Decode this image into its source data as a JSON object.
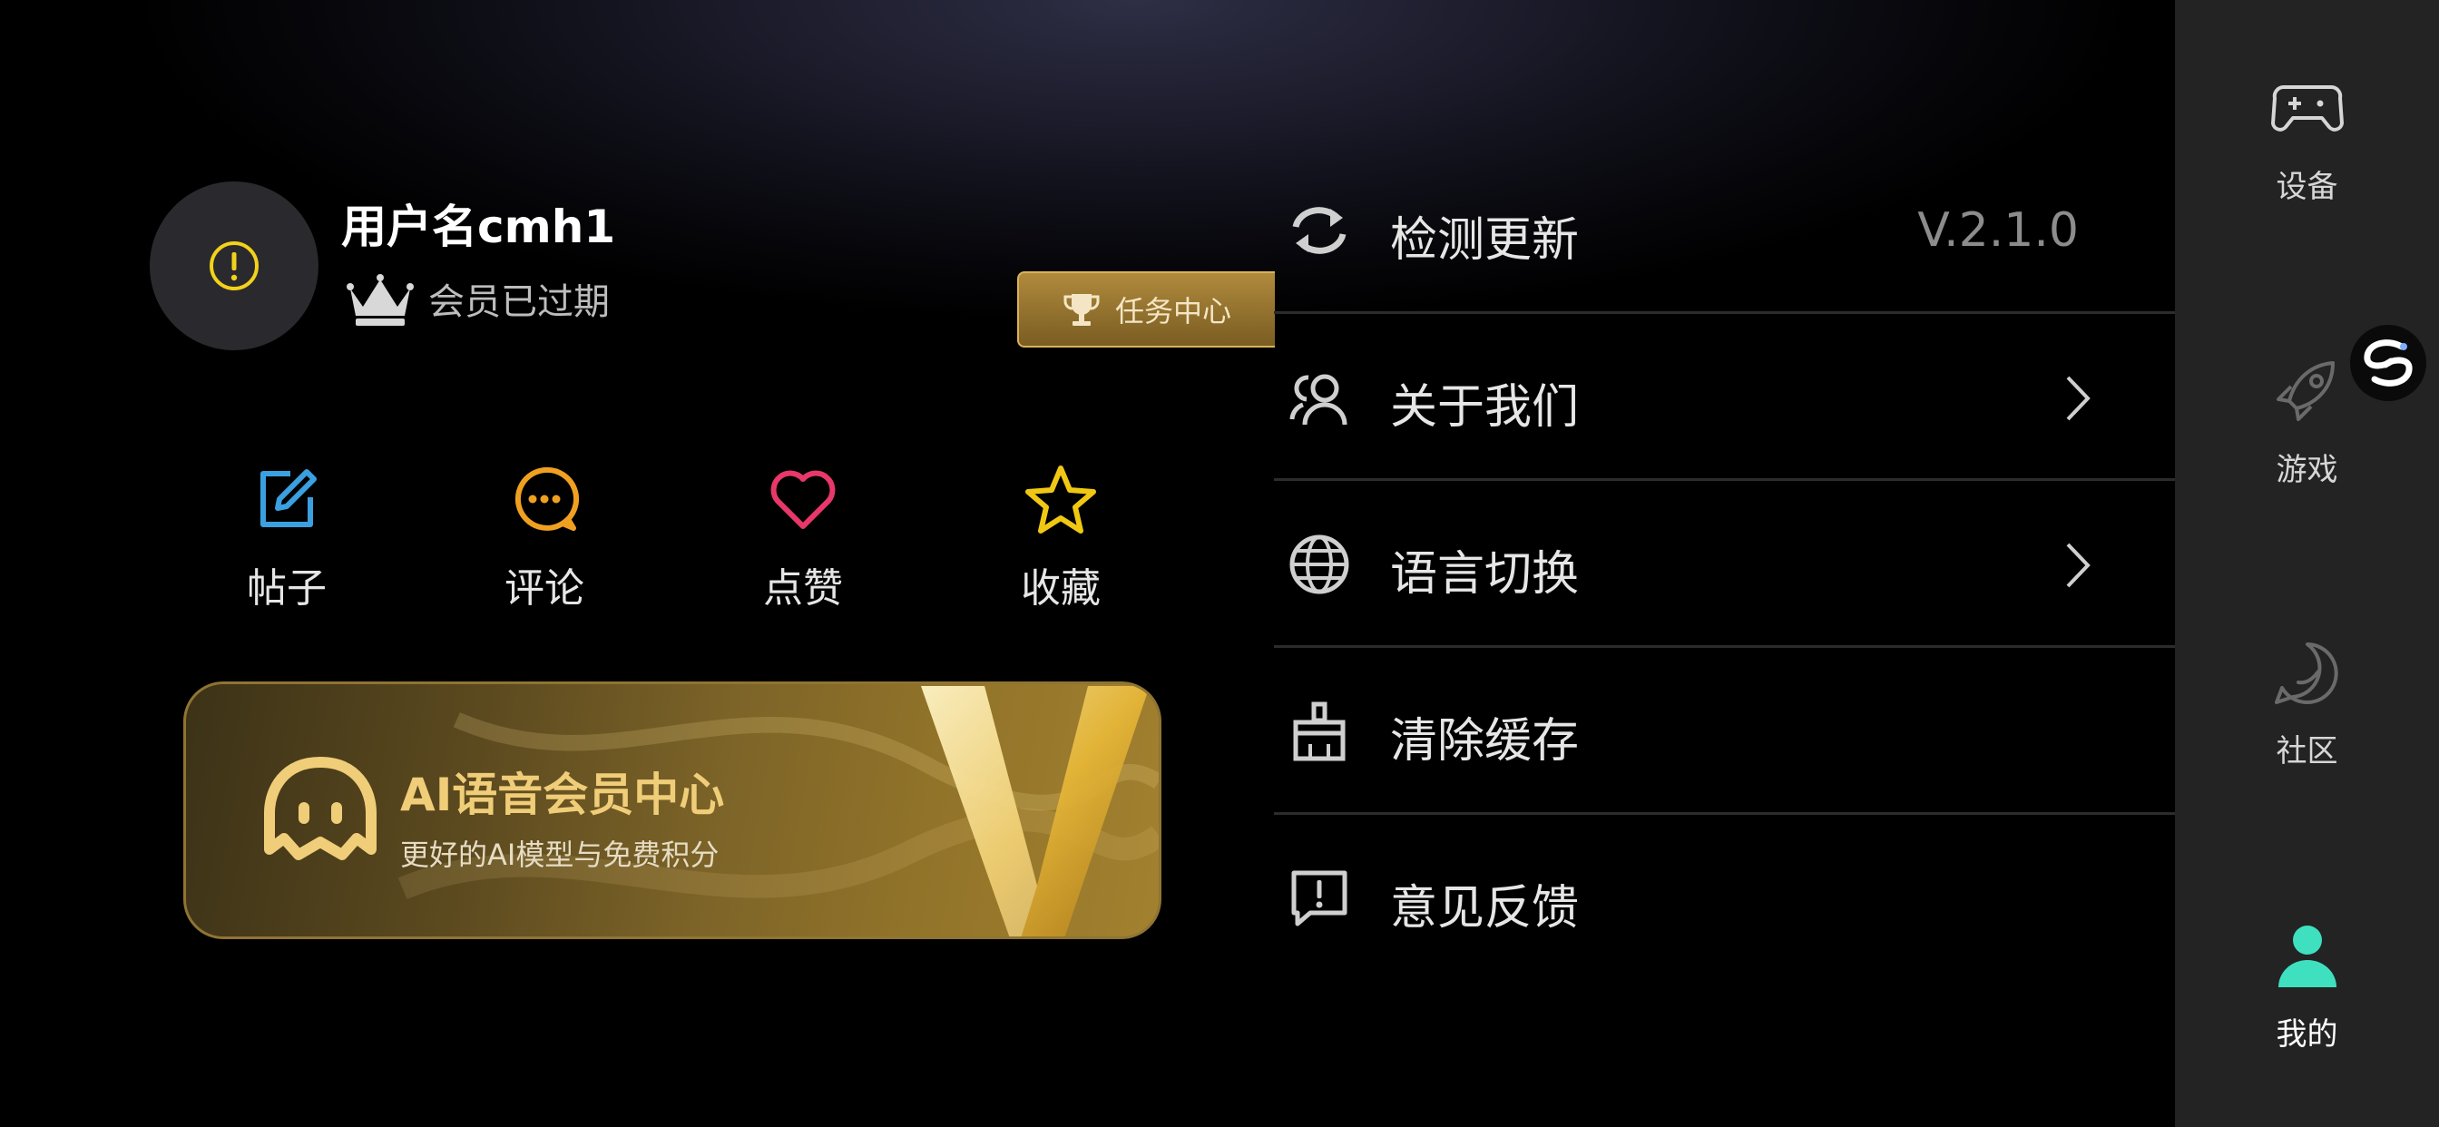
{
  "profile": {
    "username": "用户名cmh1",
    "member_status": "会员已过期",
    "avatar_icon": "warning-circle-icon",
    "task_center_label": "任务中心"
  },
  "actions": [
    {
      "label": "帖子",
      "icon": "edit-icon",
      "color": "#3aa0e0"
    },
    {
      "label": "评论",
      "icon": "comment-icon",
      "color": "#f0a020"
    },
    {
      "label": "点赞",
      "icon": "heart-icon",
      "color": "#e8386a"
    },
    {
      "label": "收藏",
      "icon": "star-icon",
      "color": "#f0c814"
    }
  ],
  "banner": {
    "title": "AI语音会员中心",
    "subtitle": "更好的AI模型与免费积分"
  },
  "settings": [
    {
      "label": "检测更新",
      "value": "V.2.1.0",
      "icon": "refresh-icon"
    },
    {
      "label": "关于我们",
      "icon": "users-icon"
    },
    {
      "label": "语言切换",
      "icon": "globe-icon"
    },
    {
      "label": "清除缓存",
      "icon": "broom-icon"
    },
    {
      "label": "意见反馈",
      "icon": "feedback-icon"
    }
  ],
  "nav": [
    {
      "label": "设备",
      "icon": "gamepad-icon"
    },
    {
      "label": "游戏",
      "icon": "rocket-icon"
    },
    {
      "label": "社区",
      "icon": "chat-icon"
    },
    {
      "label": "我的",
      "icon": "user-icon",
      "active": true
    }
  ],
  "colors": {
    "accent": "#3ee0c0",
    "gold": "#d9b25a",
    "warning": "#f2d21a"
  }
}
